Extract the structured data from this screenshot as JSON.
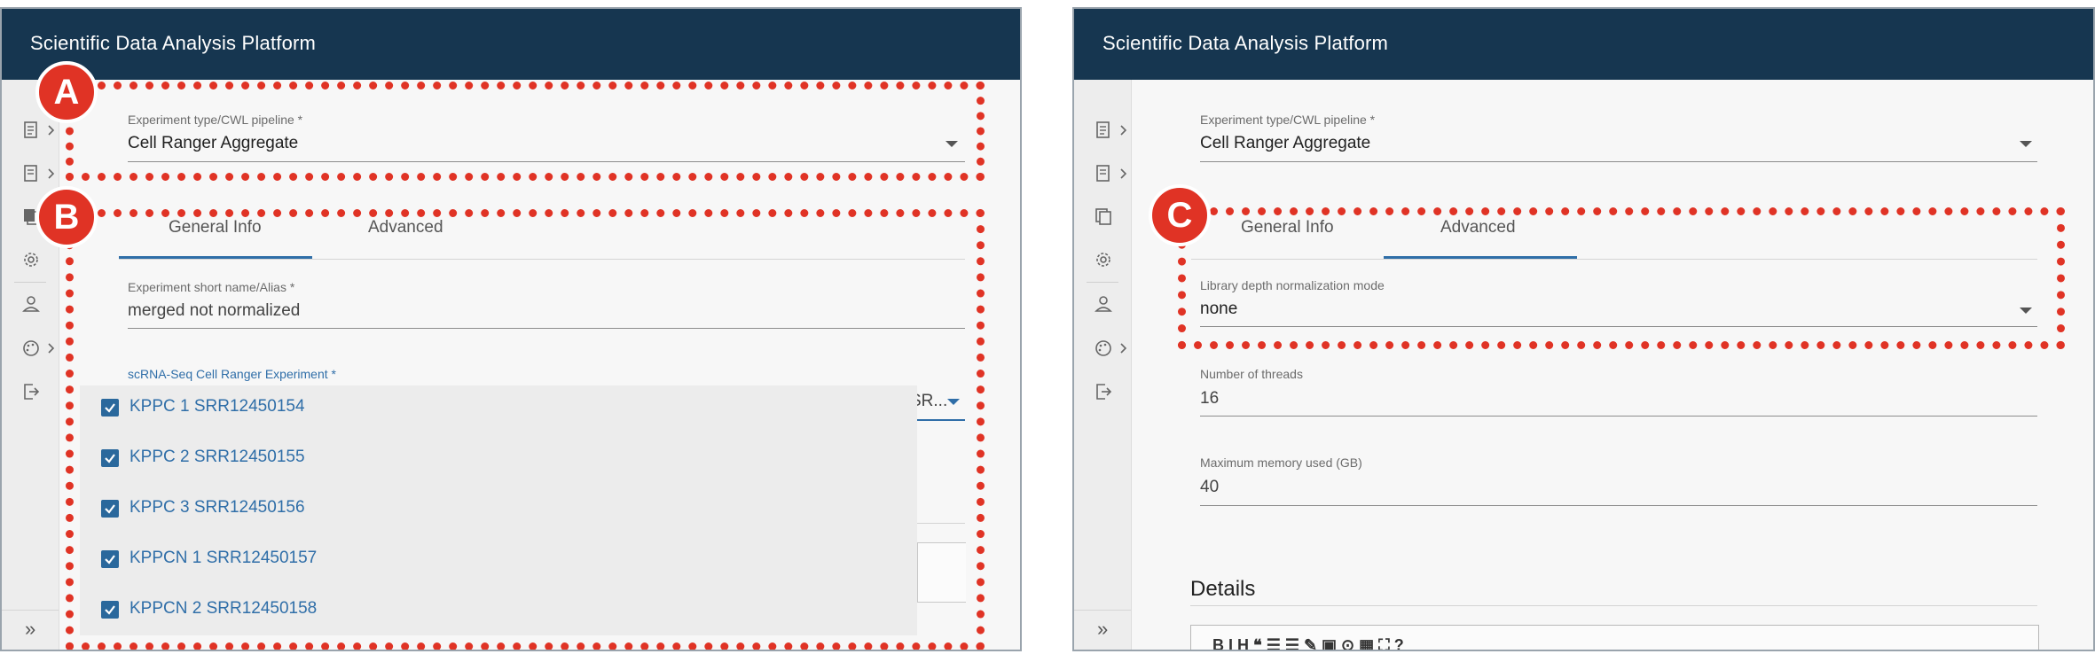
{
  "app_title": "Scientific Data Analysis Platform",
  "left": {
    "pipeline": {
      "label": "Experiment type/CWL pipeline *",
      "value": "Cell Ranger Aggregate"
    },
    "tabs": [
      {
        "label": "General Info"
      },
      {
        "label": "Advanced"
      }
    ],
    "active_tab": "General Info",
    "alias": {
      "label": "Experiment short name/Alias *",
      "value": "merged not normalized"
    },
    "experiment_select": {
      "label": "scRNA-Seq Cell Ranger Experiment *",
      "value_fragment": "SR..."
    },
    "dropdown_options": [
      {
        "label": "KPPC 1 SRR12450154",
        "checked": true
      },
      {
        "label": "KPPC 2 SRR12450155",
        "checked": true
      },
      {
        "label": "KPPC 3 SRR12450156",
        "checked": true
      },
      {
        "label": "KPPCN 1 SRR12450157",
        "checked": true
      },
      {
        "label": "KPPCN 2 SRR12450158",
        "checked": true
      }
    ]
  },
  "right": {
    "pipeline": {
      "label": "Experiment type/CWL pipeline *",
      "value": "Cell Ranger Aggregate"
    },
    "tabs": [
      {
        "label": "General Info"
      },
      {
        "label": "Advanced"
      }
    ],
    "active_tab": "Advanced",
    "normalization": {
      "label": "Library depth normalization mode",
      "value": "none"
    },
    "threads": {
      "label": "Number of threads",
      "value": "16"
    },
    "memory": {
      "label": "Maximum memory used (GB)",
      "value": "40"
    },
    "details_title": "Details",
    "editor_toolbar": "B  I  H   ❝  ☰  ☰   ✎  ▣   ⊙  ▦  ⛶   ?"
  },
  "sidebar_expand_icon": "»",
  "annotations": {
    "a": "A",
    "b": "B",
    "c": "C"
  },
  "colors": {
    "topbar": "#163650",
    "accent": "#2f6ea8",
    "annotation": "#e03325"
  }
}
